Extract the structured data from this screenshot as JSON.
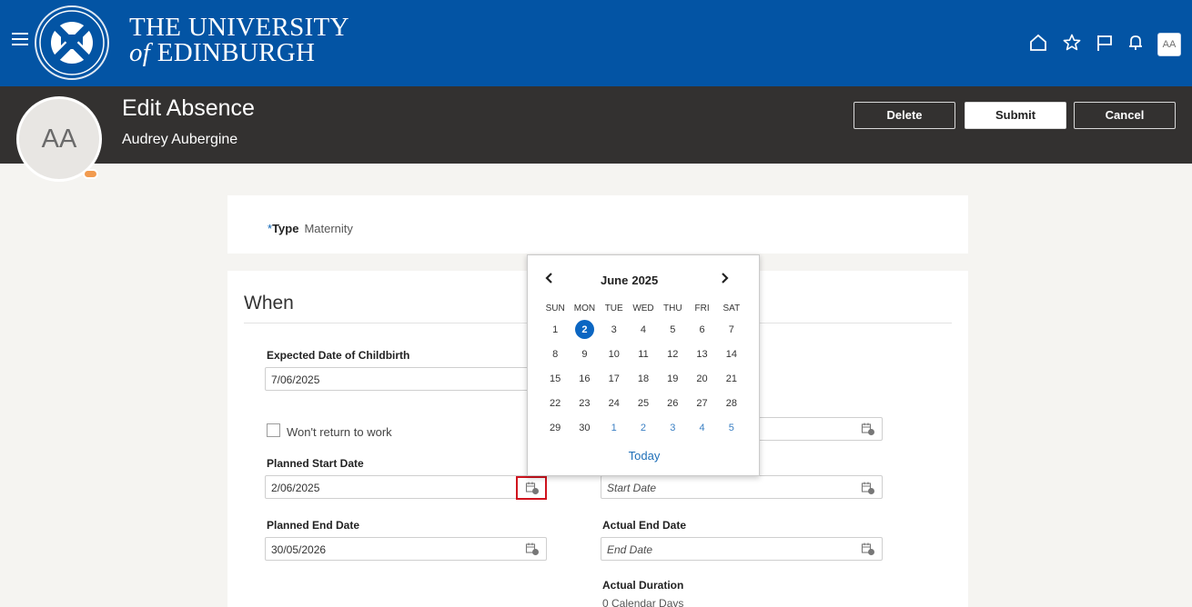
{
  "branding": {
    "line1": "THE UNIVERSITY",
    "line2_prefix": "of",
    "line2": "EDINBURGH"
  },
  "topbar": {
    "icons": [
      "menu-icon",
      "home-icon",
      "star-icon",
      "flag-icon",
      "bell-icon"
    ],
    "user_initials": "AA",
    "color": "#0354a4"
  },
  "header": {
    "title": "Edit Absence",
    "person_name": "Audrey Aubergine",
    "avatar_initials": "AA",
    "buttons": {
      "delete": "Delete",
      "submit": "Submit",
      "cancel": "Cancel"
    }
  },
  "type_section": {
    "required_marker": "*",
    "label": "Type",
    "value": "Maternity"
  },
  "when_section": {
    "title": "When",
    "expected_date_label": "Expected Date of Childbirth",
    "expected_date_value": "7/06/2025",
    "wont_return_label": "Won't return to work",
    "planned_start_label": "Planned Start Date",
    "planned_start_value": "2/06/2025",
    "planned_end_label": "Planned End Date",
    "planned_end_value": "30/05/2026",
    "actual_start_placeholder": "Start Date",
    "actual_end_label": "Actual End Date",
    "actual_end_placeholder": "End Date",
    "actual_duration_label": "Actual Duration",
    "actual_duration_value": "0 Calendar Days"
  },
  "datepicker": {
    "month": "June",
    "year": "2025",
    "weekdays": [
      "SUN",
      "MON",
      "TUE",
      "WED",
      "THU",
      "FRI",
      "SAT"
    ],
    "weeks": [
      [
        "1",
        "2",
        "3",
        "4",
        "5",
        "6",
        "7"
      ],
      [
        "8",
        "9",
        "10",
        "11",
        "12",
        "13",
        "14"
      ],
      [
        "15",
        "16",
        "17",
        "18",
        "19",
        "20",
        "21"
      ],
      [
        "22",
        "23",
        "24",
        "25",
        "26",
        "27",
        "28"
      ],
      [
        "29",
        "30",
        "1",
        "2",
        "3",
        "4",
        "5"
      ]
    ],
    "selected_day": "2",
    "today_label": "Today",
    "accent": "#0b66c2"
  }
}
